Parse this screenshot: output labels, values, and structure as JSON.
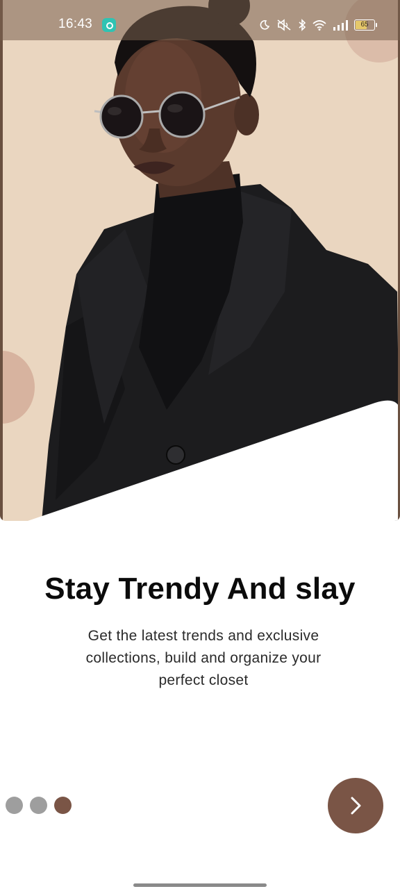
{
  "status_bar": {
    "time": "16:43",
    "battery_level": "65",
    "icons": [
      "app-notification-icon",
      "moon-icon",
      "mute-icon",
      "bluetooth-icon",
      "wifi-icon",
      "signal-icon",
      "battery-icon"
    ]
  },
  "onboarding": {
    "title": "Stay Trendy And slay",
    "description": "Get the latest trends and exclusive collections, build and organize your perfect closet"
  },
  "pager": {
    "total_pages": 3,
    "current_page": 3,
    "next_icon": "chevron-right-icon"
  },
  "colors": {
    "accent": "#7A5546",
    "dot_inactive": "#9E9E9E",
    "hero_background": "#EAD6C0",
    "title": "#0B0B0B"
  }
}
